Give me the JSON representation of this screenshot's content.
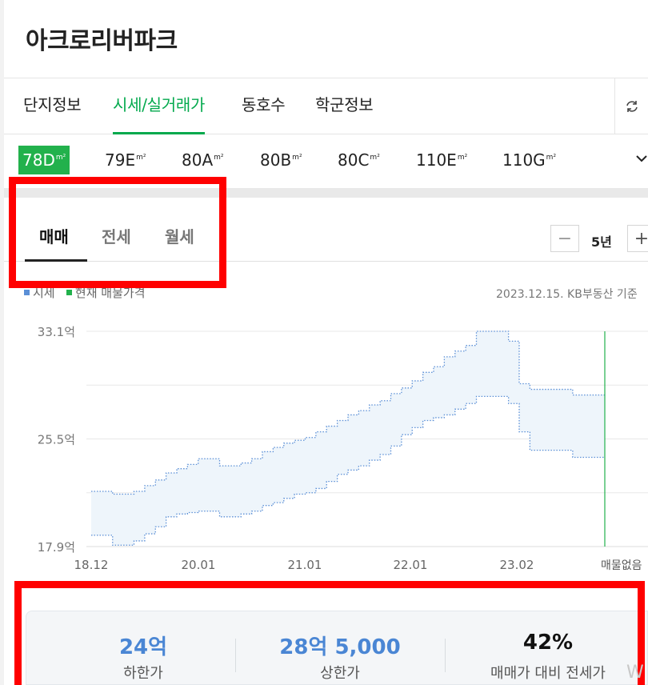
{
  "header": {
    "title": "아크로리버파크"
  },
  "tabs": [
    {
      "label": "단지정보"
    },
    {
      "label": "시세/실거래가"
    },
    {
      "label": "동호수"
    },
    {
      "label": "학군정보"
    }
  ],
  "sizes": [
    {
      "label": "78D",
      "unit": "m²"
    },
    {
      "label": "79E",
      "unit": "m²"
    },
    {
      "label": "80A",
      "unit": "m²"
    },
    {
      "label": "80B",
      "unit": "m²"
    },
    {
      "label": "80C",
      "unit": "m²"
    },
    {
      "label": "110E",
      "unit": "m²"
    },
    {
      "label": "110G",
      "unit": "m²"
    }
  ],
  "trade_tabs": [
    {
      "label": "매매"
    },
    {
      "label": "전세"
    },
    {
      "label": "월세"
    }
  ],
  "period": {
    "label": "5년",
    "minus": "−",
    "plus": "+"
  },
  "legend": {
    "market": "시세",
    "current": "현재 매물가격"
  },
  "basis": "2023.12.15. KB부동산 기준",
  "chart_data": {
    "type": "area",
    "y_ticks": [
      "33.1억",
      "25.5억",
      "17.9억"
    ],
    "ylim": [
      17.9,
      33.1
    ],
    "x_ticks": [
      "18.12",
      "20.01",
      "21.01",
      "22.01",
      "23.02"
    ],
    "end_label": "매물없음",
    "series": [
      {
        "name": "",
        "values": [
          21.8,
          21.8,
          21.6,
          21.6,
          21.8,
          22.2,
          22.6,
          23.1,
          23.4,
          23.7,
          24.1,
          24.1,
          23.6,
          23.6,
          23.8,
          24.1,
          24.6,
          24.9,
          25.2,
          25.4,
          25.6,
          26.0,
          26.4,
          26.8,
          27.2,
          27.5,
          27.9,
          28.2,
          28.7,
          29.1,
          29.6,
          30.2,
          30.6,
          31.3,
          31.7,
          32.1,
          33.1,
          33.1,
          33.1,
          32.4,
          29.4,
          29.0,
          29.0,
          29.0,
          29.0,
          28.6,
          28.6,
          28.6,
          28.6
        ]
      },
      {
        "name": "",
        "values": [
          18.7,
          18.7,
          18.0,
          18.0,
          18.3,
          18.8,
          19.3,
          20.0,
          20.2,
          20.3,
          20.4,
          20.4,
          20.0,
          20.0,
          20.2,
          20.4,
          20.8,
          21.0,
          21.3,
          21.6,
          21.7,
          22.0,
          22.5,
          23.0,
          23.3,
          23.6,
          24.0,
          24.4,
          25.0,
          25.8,
          26.3,
          26.8,
          27.0,
          27.2,
          27.6,
          28.0,
          28.5,
          28.5,
          28.5,
          28.0,
          26.0,
          24.7,
          24.7,
          24.7,
          24.7,
          24.2,
          24.2,
          24.2,
          24.2
        ]
      }
    ],
    "colors": {
      "line": "#5b8fd6",
      "fill": "#eef5fb",
      "current": "#22b14c",
      "grid": "#e8e8e8"
    }
  },
  "stats": [
    {
      "value": "24억",
      "label": "하한가",
      "color": "#4a86d4"
    },
    {
      "value": "28억 5,000",
      "label": "상한가",
      "color": "#4a86d4"
    },
    {
      "value": "42%",
      "label": "매매가 대비 전세가",
      "color": "#111111"
    }
  ],
  "watermark": "W"
}
